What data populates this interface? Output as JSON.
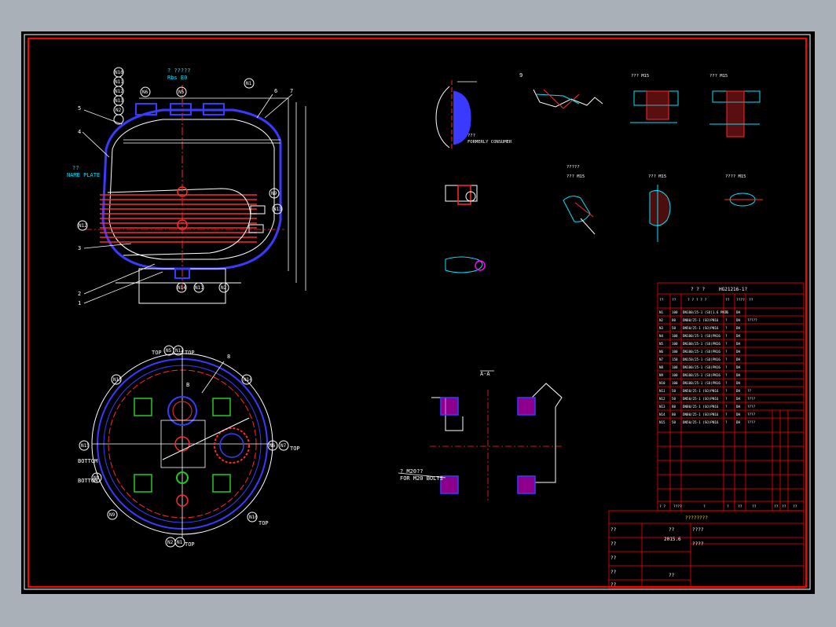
{
  "drawing": {
    "view_section_a": "A-A",
    "section_a_note": "? M20??",
    "section_a_note2": "FOR M20 BOLTS",
    "name_plate_label": "??",
    "name_plate_label2": "NAME PLATE",
    "detail_top_label": "? ?????",
    "detail_top_label2": "Rbs E0",
    "detail_notes": [
      "??? ",
      "FORMERLY CONSUMER",
      "??? M15",
      "??? M15",
      "?????",
      "??? M15",
      "??? M15",
      "???? M15"
    ],
    "part_numbers": [
      "1",
      "2",
      "3",
      "4",
      "5",
      "6",
      "7",
      "8",
      "9",
      "B"
    ],
    "nozzle_tags_side": [
      "N10",
      "N11",
      "N12",
      "N13",
      "N2",
      "N6",
      "N5",
      "N1",
      "N9",
      "N13",
      "N12",
      "N14",
      "N11",
      "N2",
      "N4"
    ],
    "nozzle_tags_top": [
      "N5",
      "N12",
      "N13",
      "N14",
      "N15",
      "N6",
      "N7",
      "N8",
      "N9",
      "N10",
      "N2",
      "N1"
    ],
    "plan_labels": [
      "TOP",
      "TOP",
      "BOTTOM",
      "BOTTOM",
      "TOP",
      "TOP",
      "TOP"
    ]
  },
  "nozzle_table": {
    "title": "? ? ?",
    "subtitle": "HG21216-1?",
    "headers": [
      "??",
      "??",
      "? ? ? ? ?",
      "??",
      "????",
      "??"
    ],
    "rows": [
      [
        "N1",
        "100",
        "DN100/25-1 (SO)1.6 PN16",
        "?",
        "DH",
        ""
      ],
      [
        "N2",
        "80",
        "DN80/25-1 (SO)PN16",
        "?",
        "DH",
        "?????"
      ],
      [
        "N3",
        "50",
        "DN50/25-1 (SO)PN16",
        "?",
        "DH",
        ""
      ],
      [
        "N4",
        "100",
        "DN100/25-1 (SO)PN16",
        "?",
        "DH",
        ""
      ],
      [
        "N5",
        "100",
        "DN100/25-1 (SO)PN16",
        "?",
        "DH",
        ""
      ],
      [
        "N6",
        "100",
        "DN100/25-1 (SO)PN16",
        "?",
        "DH",
        ""
      ],
      [
        "N7",
        "150",
        "DN150/25-1 (SO)PN16",
        "?",
        "DH",
        ""
      ],
      [
        "N8",
        "100",
        "DN100/25-1 (SO)PN16",
        "?",
        "DH",
        ""
      ],
      [
        "N9",
        "100",
        "DN100/25-1 (SO)PN16",
        "?",
        "DH",
        ""
      ],
      [
        "N10",
        "100",
        "DN100/25-1 (SO)PN16",
        "?",
        "DH",
        ""
      ],
      [
        "N11",
        "50",
        "DN50/25-1 (SO)PN16",
        "?",
        "DH",
        "??"
      ],
      [
        "N12",
        "50",
        "DN50/25-1 (SO)PN16",
        "?",
        "DH",
        "????"
      ],
      [
        "N13",
        "80",
        "DN80/25-1 (SO)PN16",
        "?",
        "DH",
        "????"
      ],
      [
        "N14",
        "80",
        "DN80/25-1 (SO)PN16",
        "?",
        "DH",
        "????"
      ],
      [
        "N15",
        "50",
        "DN50/25-1 (SO)PN16",
        "?",
        "DH",
        "????"
      ]
    ],
    "footer": [
      "? ?",
      "????",
      "?",
      "?",
      "??",
      "??",
      "??",
      "??",
      "??"
    ]
  },
  "title_block": {
    "title": "????????",
    "rows": [
      {
        "left": "??",
        "mid": "??",
        "right": "????"
      },
      {
        "left": "??",
        "mid": "2015.6",
        "right": ""
      },
      {
        "left": "??",
        "mid": "",
        "right": "????"
      },
      {
        "left": "??",
        "mid": "",
        "right": ""
      },
      {
        "left": "??",
        "mid": "??",
        "right": ""
      }
    ]
  },
  "colors": {
    "background": "#000000",
    "frame": "#ff0000",
    "outer_frame": "#ffffff",
    "vessel": "#3a3aff",
    "coil": "#ff2a2a",
    "text": "#ffffff",
    "detail": "#00e5ff",
    "nozzle_fill": "#ff00ff",
    "green": "#22cc22",
    "yellow": "#ffd800"
  }
}
